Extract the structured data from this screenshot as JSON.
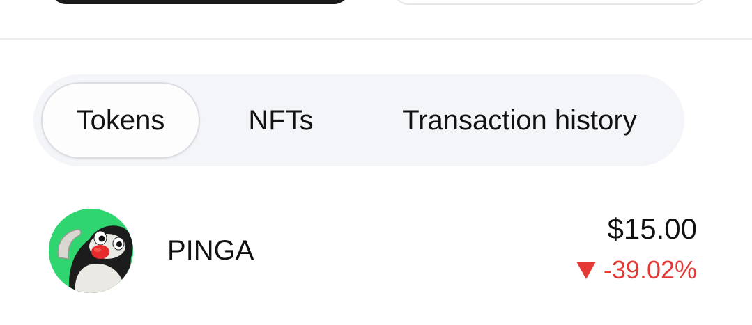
{
  "tabs": [
    {
      "label": "Tokens",
      "active": true
    },
    {
      "label": "NFTs",
      "active": false
    },
    {
      "label": "Transaction history",
      "active": false
    }
  ],
  "token": {
    "name": "PINGA",
    "price": "$15.00",
    "change": "-39.02%",
    "change_direction": "down",
    "change_color": "#e53935",
    "avatar_icon": "pingu-penguin-avatar",
    "avatar_bg": "#2fd66f"
  }
}
